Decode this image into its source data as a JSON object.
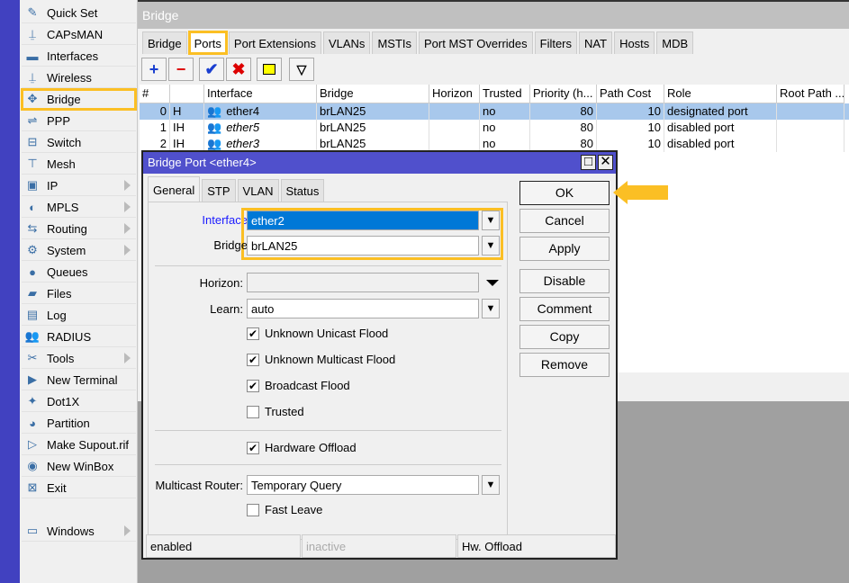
{
  "sidebar": {
    "items": [
      {
        "label": "Quick Set",
        "icon": "wand-icon"
      },
      {
        "label": "CAPsMAN",
        "icon": "antenna-icon"
      },
      {
        "label": "Interfaces",
        "icon": "interface-card-icon"
      },
      {
        "label": "Wireless",
        "icon": "antenna-icon"
      },
      {
        "label": "Bridge",
        "icon": "bridge-icon",
        "selected": true
      },
      {
        "label": "PPP",
        "icon": "ppp-icon"
      },
      {
        "label": "Switch",
        "icon": "switch-icon"
      },
      {
        "label": "Mesh",
        "icon": "mesh-icon"
      },
      {
        "label": "IP",
        "icon": "ip-icon",
        "submenu": true
      },
      {
        "label": "MPLS",
        "icon": "mpls-icon",
        "submenu": true
      },
      {
        "label": "Routing",
        "icon": "routing-icon",
        "submenu": true
      },
      {
        "label": "System",
        "icon": "gear-icon",
        "submenu": true
      },
      {
        "label": "Queues",
        "icon": "queues-icon"
      },
      {
        "label": "Files",
        "icon": "folder-icon"
      },
      {
        "label": "Log",
        "icon": "log-icon"
      },
      {
        "label": "RADIUS",
        "icon": "users-icon"
      },
      {
        "label": "Tools",
        "icon": "tools-icon",
        "submenu": true
      },
      {
        "label": "New Terminal",
        "icon": "terminal-icon"
      },
      {
        "label": "Dot1X",
        "icon": "dot1x-icon"
      },
      {
        "label": "Partition",
        "icon": "pie-icon"
      },
      {
        "label": "Make Supout.rif",
        "icon": "supout-icon"
      },
      {
        "label": "New WinBox",
        "icon": "winbox-icon"
      },
      {
        "label": "Exit",
        "icon": "exit-icon"
      }
    ],
    "windows": {
      "label": "Windows",
      "icon": "windows-icon",
      "submenu": true
    }
  },
  "bridge_window": {
    "title": "Bridge",
    "tabs": [
      "Bridge",
      "Ports",
      "Port Extensions",
      "VLANs",
      "MSTIs",
      "Port MST Overrides",
      "Filters",
      "NAT",
      "Hosts",
      "MDB"
    ],
    "active_tab": "Ports",
    "columns": [
      "#",
      "",
      "Interface",
      "Bridge",
      "Horizon",
      "Trusted",
      "Priority (h...",
      "Path Cost",
      "Role",
      "Root Path ..."
    ],
    "rows": [
      [
        "0",
        "H",
        "ether4",
        "brLAN25",
        "",
        "no",
        "80",
        "10",
        "designated port",
        ""
      ],
      [
        "1",
        "IH",
        "ether5",
        "brLAN25",
        "",
        "no",
        "80",
        "10",
        "disabled port",
        ""
      ],
      [
        "2",
        "IH",
        "ether3",
        "brLAN25",
        "",
        "no",
        "80",
        "10",
        "disabled port",
        ""
      ]
    ]
  },
  "dialog": {
    "title": "Bridge Port <ether4>",
    "tabs": [
      "General",
      "STP",
      "VLAN",
      "Status"
    ],
    "interface_label": "Interface",
    "interface_value": "ether2",
    "bridge_label": "Bridge",
    "bridge_value": "brLAN25",
    "horizon_label": "Horizon:",
    "horizon_value": "",
    "learn_label": "Learn:",
    "learn_value": "auto",
    "checks": [
      {
        "label": "Unknown Unicast Flood",
        "checked": true
      },
      {
        "label": "Unknown Multicast Flood",
        "checked": true
      },
      {
        "label": "Broadcast Flood",
        "checked": true
      },
      {
        "label": "Trusted",
        "checked": false
      }
    ],
    "hw_offload": {
      "label": "Hardware Offload",
      "checked": true
    },
    "mcast_label": "Multicast Router:",
    "mcast_value": "Temporary Query",
    "fast_leave": {
      "label": "Fast Leave",
      "checked": false
    },
    "buttons": [
      "OK",
      "Cancel",
      "Apply",
      "Disable",
      "Comment",
      "Copy",
      "Remove"
    ],
    "status": [
      "enabled",
      "inactive",
      "Hw. Offload"
    ]
  },
  "colors": {
    "highlight": "#fbbf24",
    "title_bar": "#5050cc",
    "selection": "#0078d7"
  }
}
